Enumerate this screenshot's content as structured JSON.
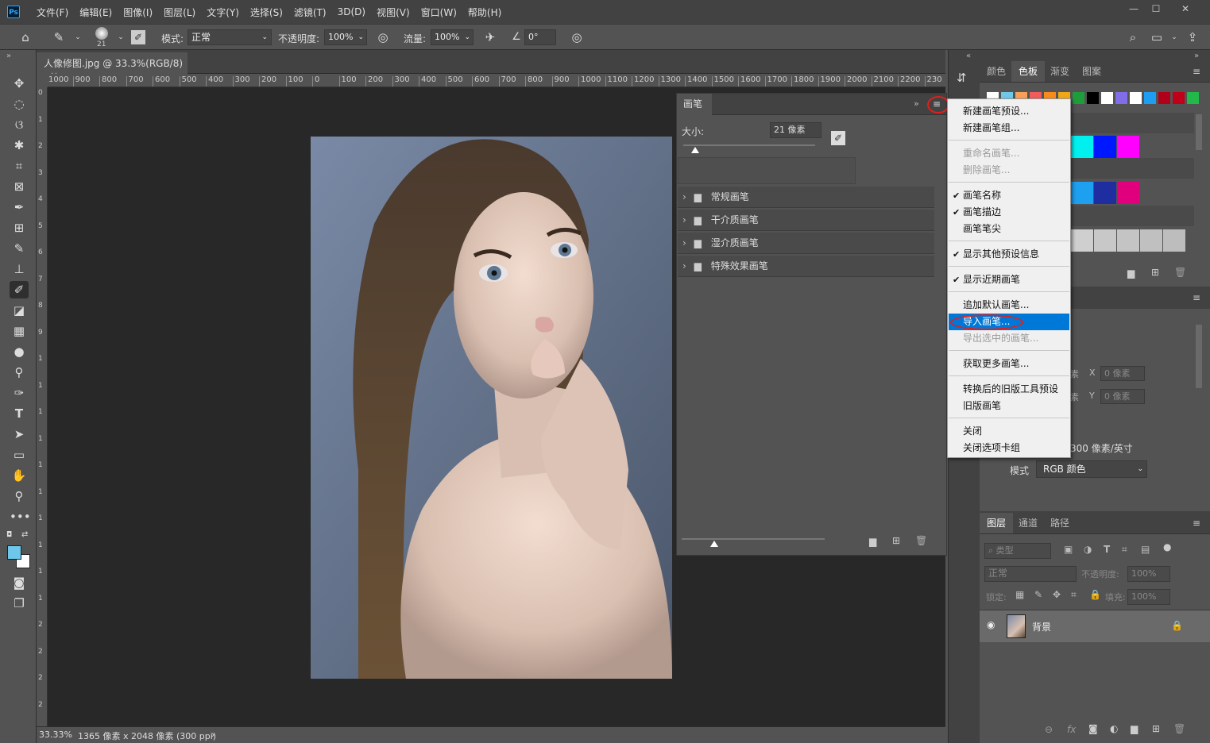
{
  "app": {
    "logo": "Ps"
  },
  "menubar": {
    "items": [
      "文件(F)",
      "编辑(E)",
      "图像(I)",
      "图层(L)",
      "文字(Y)",
      "选择(S)",
      "滤镜(T)",
      "3D(D)",
      "视图(V)",
      "窗口(W)",
      "帮助(H)"
    ],
    "window_controls": {
      "minimize": "—",
      "maximize": "☐",
      "close": "✕"
    }
  },
  "options": {
    "brush_size": "21",
    "mode_label": "模式:",
    "mode_value": "正常",
    "opacity_label": "不透明度:",
    "opacity_value": "100%",
    "flow_label": "流量:",
    "flow_value": "100%",
    "angle_value": "0°"
  },
  "document": {
    "tab_title": "人像修图.jpg @ 33.3%(RGB/8)",
    "tab_close": "×",
    "zoom": "33.33%",
    "size_info": "1365 像素 x 2048 像素 (300 ppi)",
    "status_arrow": "›"
  },
  "ruler": {
    "top_ticks": [
      "1000",
      "900",
      "800",
      "700",
      "600",
      "500",
      "400",
      "300",
      "200",
      "100",
      "0",
      "100",
      "200",
      "300",
      "400",
      "500",
      "600",
      "700",
      "800",
      "900",
      "1000",
      "1100",
      "1200",
      "1300",
      "1400",
      "1500",
      "1600",
      "1700",
      "1800",
      "1900",
      "2000",
      "2100",
      "2200",
      "230"
    ],
    "left_ticks": [
      "0",
      "1",
      "2",
      "3",
      "4",
      "5",
      "6",
      "7",
      "8",
      "9",
      "1",
      "1",
      "1",
      "1",
      "1",
      "1",
      "1",
      "1",
      "1",
      "1",
      "2",
      "2",
      "2",
      "2",
      "2"
    ]
  },
  "brush_panel": {
    "title": "画笔",
    "size_label": "大小:",
    "size_value": "21 像素",
    "folders": [
      "常规画笔",
      "干介质画笔",
      "湿介质画笔",
      "特殊效果画笔"
    ]
  },
  "dropdown": {
    "items": [
      {
        "label": "新建画笔预设...",
        "state": "normal",
        "checked": false
      },
      {
        "label": "新建画笔组...",
        "state": "normal",
        "checked": false
      },
      {
        "label": "重命名画笔...",
        "state": "disabled",
        "checked": false
      },
      {
        "label": "删除画笔...",
        "state": "disabled",
        "checked": false
      },
      {
        "label": "画笔名称",
        "state": "normal",
        "checked": true
      },
      {
        "label": "画笔描边",
        "state": "normal",
        "checked": true
      },
      {
        "label": "画笔笔尖",
        "state": "normal",
        "checked": false
      },
      {
        "label": "显示其他预设信息",
        "state": "normal",
        "checked": true
      },
      {
        "label": "显示近期画笔",
        "state": "normal",
        "checked": true
      },
      {
        "label": "追加默认画笔...",
        "state": "normal",
        "checked": false
      },
      {
        "label": "导入画笔...",
        "state": "highlighted",
        "checked": false
      },
      {
        "label": "导出选中的画笔...",
        "state": "disabled",
        "checked": false
      },
      {
        "label": "获取更多画笔...",
        "state": "normal",
        "checked": false
      },
      {
        "label": "转换后的旧版工具预设",
        "state": "normal",
        "checked": false
      },
      {
        "label": "旧版画笔",
        "state": "normal",
        "checked": false
      },
      {
        "label": "关闭",
        "state": "normal",
        "checked": false
      },
      {
        "label": "关闭选项卡组",
        "state": "normal",
        "checked": false
      }
    ],
    "checkmark": "✔"
  },
  "swatches_panel": {
    "tabs": [
      "颜色",
      "色板",
      "渐变",
      "图案"
    ],
    "active_tab": "色板",
    "row1_colors": [
      "#ffffff",
      "#6fc8e8",
      "#f7a05a",
      "#f25c5c",
      "#f78b1e",
      "#f0a818",
      "#1e9e3a",
      "#000000",
      "#ffffff",
      "#7f6ee8",
      "#ffffff",
      "#1e9ef0",
      "#b0001a",
      "#c00018",
      "#22b94a"
    ],
    "row2_colors": [
      "#00f0f0",
      "#0018ff",
      "#ff00ff"
    ],
    "row3_colors": [
      "#1ea0f0",
      "#1e2ea0",
      "#e0007e"
    ],
    "row4_colors": [
      "#cfcfcf",
      "#c8c8c8",
      "#c4c4c4",
      "#c0c0c0",
      "#bdbdbd"
    ]
  },
  "properties_panel": {
    "x_label": "X",
    "x_value": "0 像素",
    "y_label": "Y",
    "y_value": "0 像素",
    "partial_unit": "素",
    "resolution": "300 像素/英寸",
    "mode_label": "模式",
    "mode_value": "RGB 颜色"
  },
  "layers_panel": {
    "tabs": [
      "图层",
      "通道",
      "路径"
    ],
    "active_tab": "图层",
    "filter_placeholder": "类型",
    "blend_mode": "正常",
    "opacity_label": "不透明度:",
    "opacity_value": "100%",
    "lock_label": "锁定:",
    "fill_label": "填充:",
    "fill_value": "100%",
    "layers": [
      {
        "name": "背景",
        "visible": true,
        "locked": true
      }
    ]
  },
  "colors": {
    "foreground": "#6ec6ea",
    "background": "#ffffff",
    "menu_highlight": "#0078d7",
    "annotation_red": "#e0201c"
  }
}
